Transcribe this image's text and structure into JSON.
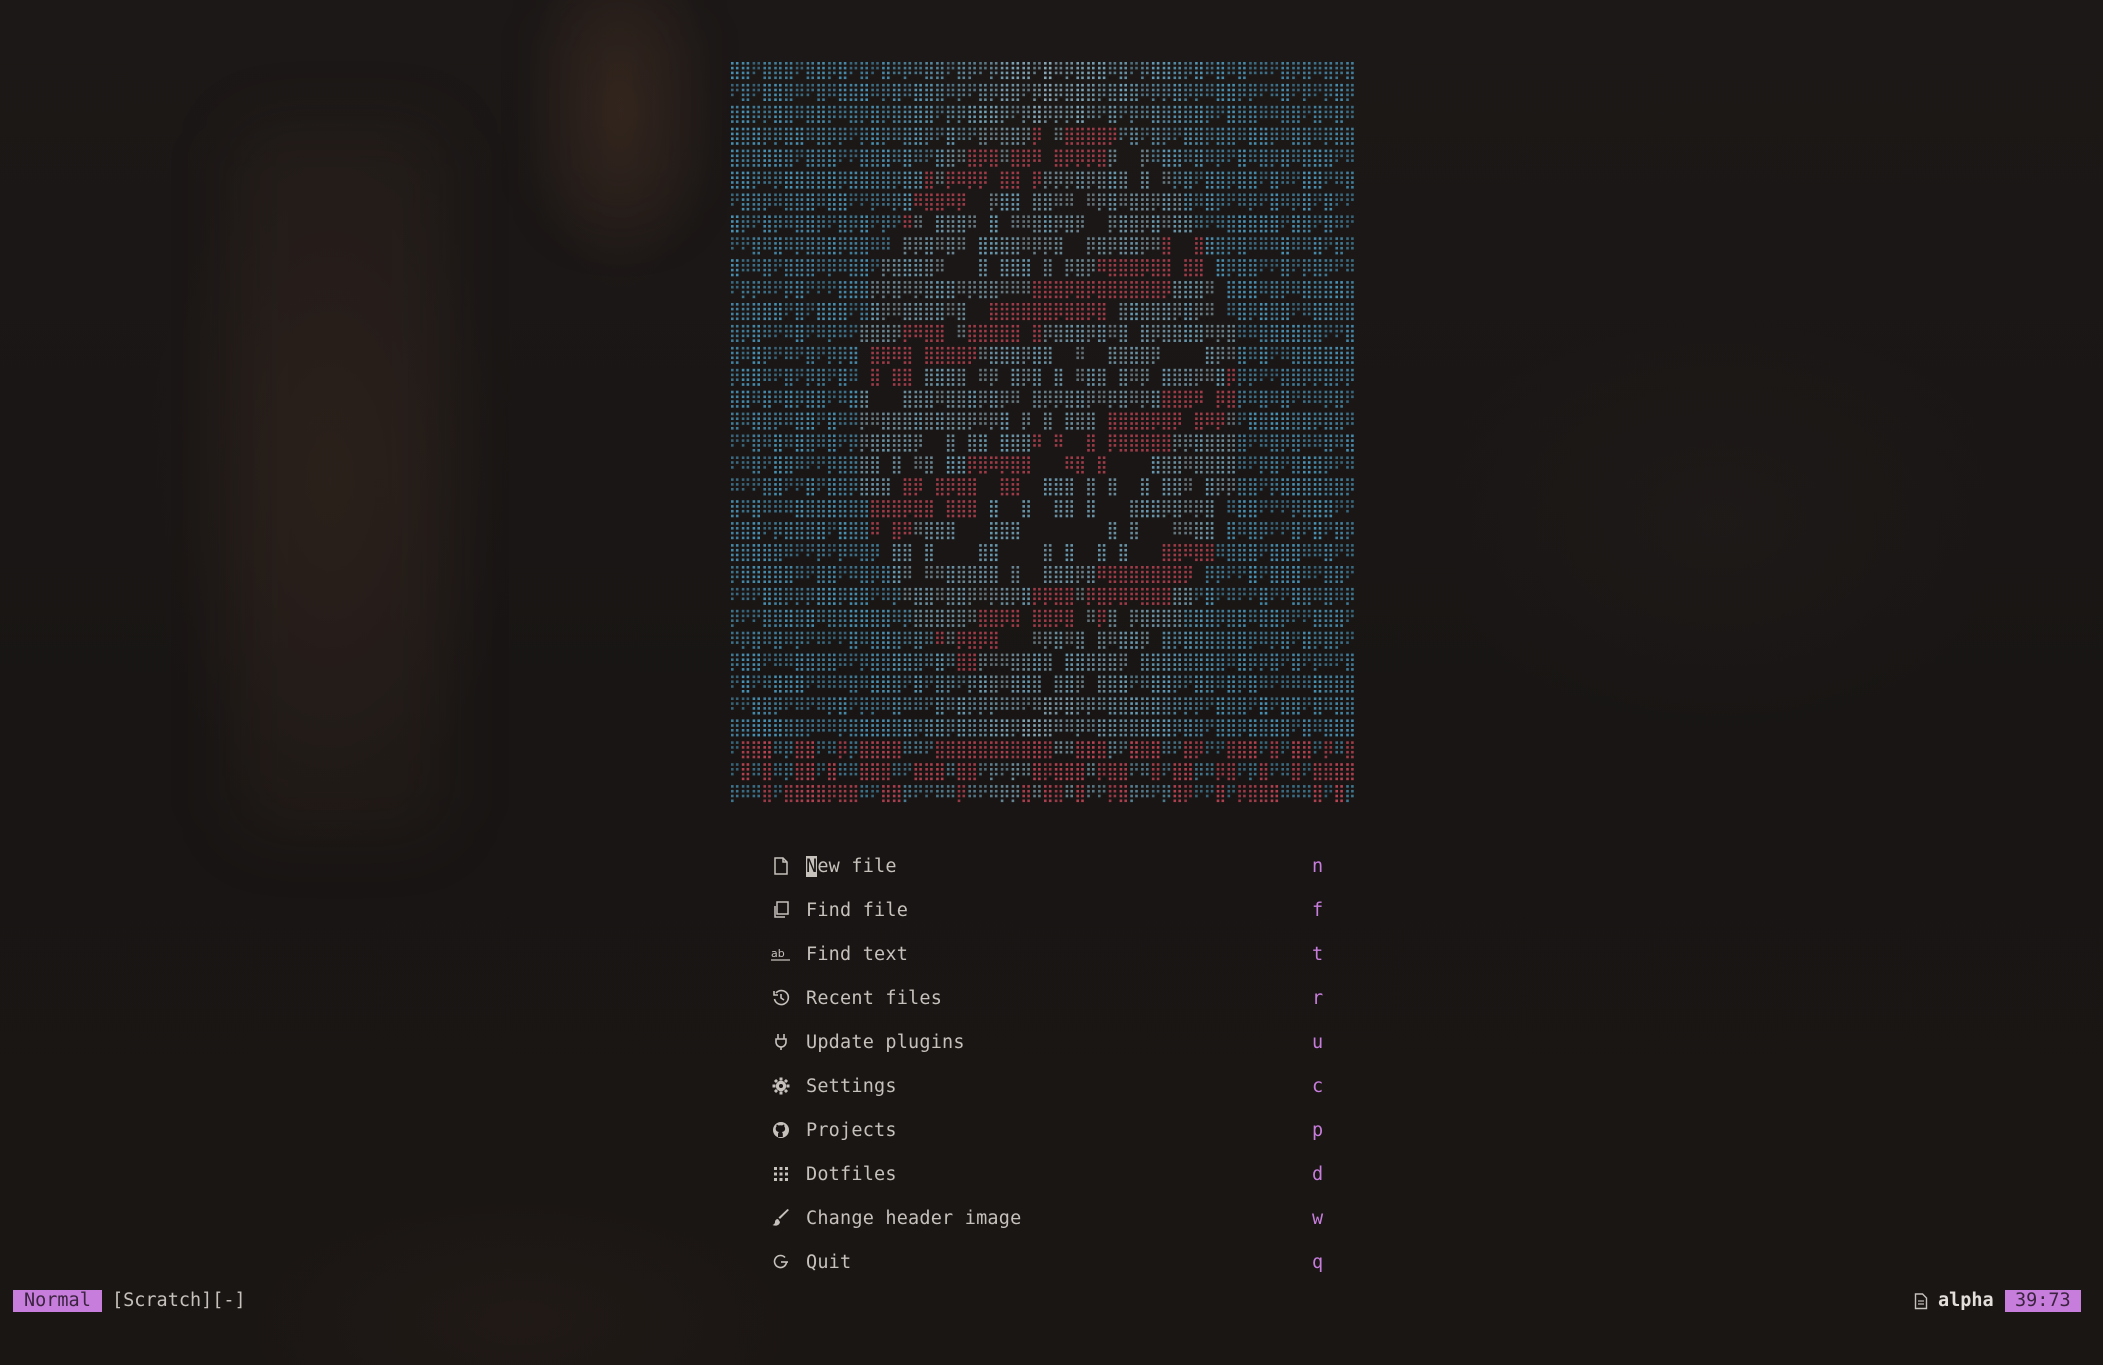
{
  "dashboard": {
    "header_image": "ascii-portrait-art",
    "menu": [
      {
        "icon": "file-icon",
        "label": "New file",
        "key": "n"
      },
      {
        "icon": "copy-files-icon",
        "label": "Find file",
        "key": "f"
      },
      {
        "icon": "text-search-icon",
        "label": "Find text",
        "key": "t"
      },
      {
        "icon": "history-icon",
        "label": "Recent files",
        "key": "r"
      },
      {
        "icon": "plug-icon",
        "label": "Update plugins",
        "key": "u"
      },
      {
        "icon": "gear-icon",
        "label": "Settings",
        "key": "c"
      },
      {
        "icon": "github-icon",
        "label": "Projects",
        "key": "p"
      },
      {
        "icon": "grid-icon",
        "label": "Dotfiles",
        "key": "d"
      },
      {
        "icon": "brush-icon",
        "label": "Change header image",
        "key": "w"
      },
      {
        "icon": "power-icon",
        "label": "Quit",
        "key": "q"
      }
    ]
  },
  "statusline": {
    "mode": "Normal",
    "buffer": "[Scratch][-]",
    "filetype": "alpha",
    "position": "39:73"
  },
  "colors": {
    "background": "#171413",
    "accent": "#c77ddb",
    "text": "#c7c1bc",
    "ascii_blue": "#4f9fc4",
    "ascii_red": "#c9485a",
    "ascii_white": "#e8e2dc"
  }
}
